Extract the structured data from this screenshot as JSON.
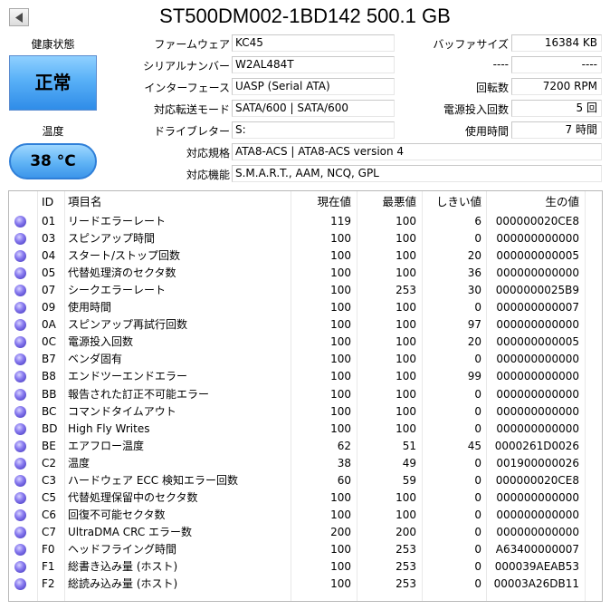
{
  "title": "ST500DM002-1BD142 500.1 GB",
  "health": {
    "label": "健康状態",
    "status": "正常",
    "color": "#4ba3f0"
  },
  "temperature": {
    "label": "温度",
    "value": "38 °C"
  },
  "info_left": [
    {
      "label": "ファームウェア",
      "value": "KC45"
    },
    {
      "label": "シリアルナンバー",
      "value": "W2AL484T"
    },
    {
      "label": "インターフェース",
      "value": "UASP (Serial ATA)"
    },
    {
      "label": "対応転送モード",
      "value": "SATA/600 | SATA/600"
    },
    {
      "label": "ドライブレター",
      "value": "S:"
    }
  ],
  "info_right": [
    {
      "label": "バッファサイズ",
      "value": "16384 KB"
    },
    {
      "label": "----",
      "value": "----"
    },
    {
      "label": "回転数",
      "value": "7200 RPM"
    },
    {
      "label": "電源投入回数",
      "value": "5 回"
    },
    {
      "label": "使用時間",
      "value": "7 時間"
    }
  ],
  "standard": {
    "label": "対応規格",
    "value": "ATA8-ACS | ATA8-ACS version 4"
  },
  "features": {
    "label": "対応機能",
    "value": "S.M.A.R.T., AAM, NCQ, GPL"
  },
  "table": {
    "headers": {
      "id": "ID",
      "name": "項目名",
      "current": "現在値",
      "worst": "最悪値",
      "threshold": "しきい値",
      "raw": "生の値"
    },
    "rows": [
      {
        "id": "01",
        "name": "リードエラーレート",
        "current": "119",
        "worst": "100",
        "threshold": "6",
        "raw": "000000020CE8"
      },
      {
        "id": "03",
        "name": "スピンアップ時間",
        "current": "100",
        "worst": "100",
        "threshold": "0",
        "raw": "000000000000"
      },
      {
        "id": "04",
        "name": "スタート/ストップ回数",
        "current": "100",
        "worst": "100",
        "threshold": "20",
        "raw": "000000000005"
      },
      {
        "id": "05",
        "name": "代替処理済のセクタ数",
        "current": "100",
        "worst": "100",
        "threshold": "36",
        "raw": "000000000000"
      },
      {
        "id": "07",
        "name": "シークエラーレート",
        "current": "100",
        "worst": "253",
        "threshold": "30",
        "raw": "0000000025B9"
      },
      {
        "id": "09",
        "name": "使用時間",
        "current": "100",
        "worst": "100",
        "threshold": "0",
        "raw": "000000000007"
      },
      {
        "id": "0A",
        "name": "スピンアップ再試行回数",
        "current": "100",
        "worst": "100",
        "threshold": "97",
        "raw": "000000000000"
      },
      {
        "id": "0C",
        "name": "電源投入回数",
        "current": "100",
        "worst": "100",
        "threshold": "20",
        "raw": "000000000005"
      },
      {
        "id": "B7",
        "name": "ベンダ固有",
        "current": "100",
        "worst": "100",
        "threshold": "0",
        "raw": "000000000000"
      },
      {
        "id": "B8",
        "name": "エンドツーエンドエラー",
        "current": "100",
        "worst": "100",
        "threshold": "99",
        "raw": "000000000000"
      },
      {
        "id": "BB",
        "name": "報告された訂正不可能エラー",
        "current": "100",
        "worst": "100",
        "threshold": "0",
        "raw": "000000000000"
      },
      {
        "id": "BC",
        "name": "コマンドタイムアウト",
        "current": "100",
        "worst": "100",
        "threshold": "0",
        "raw": "000000000000"
      },
      {
        "id": "BD",
        "name": "High Fly Writes",
        "current": "100",
        "worst": "100",
        "threshold": "0",
        "raw": "000000000000"
      },
      {
        "id": "BE",
        "name": "エアフロー温度",
        "current": "62",
        "worst": "51",
        "threshold": "45",
        "raw": "0000261D0026"
      },
      {
        "id": "C2",
        "name": "温度",
        "current": "38",
        "worst": "49",
        "threshold": "0",
        "raw": "001900000026"
      },
      {
        "id": "C3",
        "name": "ハードウェア ECC 検知エラー回数",
        "current": "60",
        "worst": "59",
        "threshold": "0",
        "raw": "000000020CE8"
      },
      {
        "id": "C5",
        "name": "代替処理保留中のセクタ数",
        "current": "100",
        "worst": "100",
        "threshold": "0",
        "raw": "000000000000"
      },
      {
        "id": "C6",
        "name": "回復不可能セクタ数",
        "current": "100",
        "worst": "100",
        "threshold": "0",
        "raw": "000000000000"
      },
      {
        "id": "C7",
        "name": "UltraDMA CRC エラー数",
        "current": "200",
        "worst": "200",
        "threshold": "0",
        "raw": "000000000000"
      },
      {
        "id": "F0",
        "name": "ヘッドフライング時間",
        "current": "100",
        "worst": "253",
        "threshold": "0",
        "raw": "A63400000007"
      },
      {
        "id": "F1",
        "name": "総書き込み量 (ホスト)",
        "current": "100",
        "worst": "253",
        "threshold": "0",
        "raw": "000039AEAB53"
      },
      {
        "id": "F2",
        "name": "総読み込み量 (ホスト)",
        "current": "100",
        "worst": "253",
        "threshold": "0",
        "raw": "00003A26DB11"
      }
    ]
  }
}
